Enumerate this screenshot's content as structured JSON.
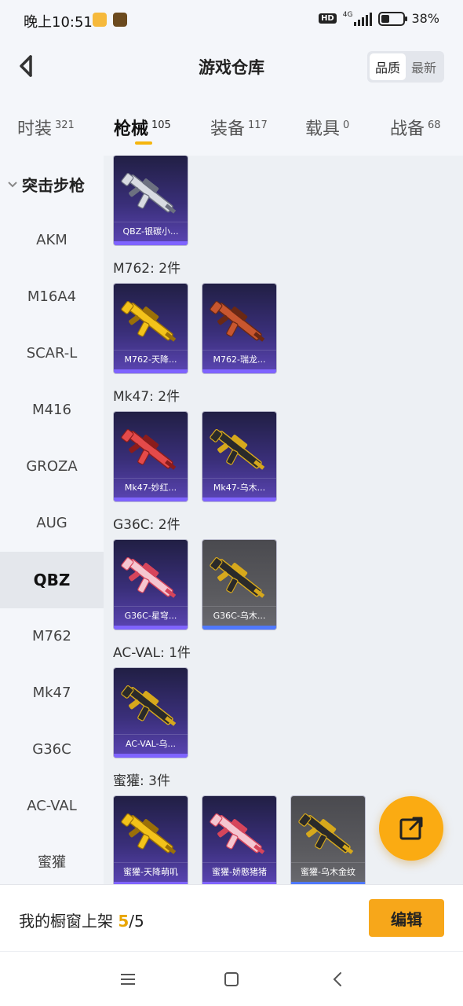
{
  "status": {
    "time": "晚上10:51",
    "network": "4G",
    "hd": "HD",
    "battery_percent": "38%",
    "battery_level": 0.38
  },
  "header": {
    "title": "游戏仓库",
    "sort_options": [
      "品质",
      "最新"
    ],
    "sort_active": 0
  },
  "tabs": [
    {
      "label": "时装",
      "count": "321"
    },
    {
      "label": "枪械",
      "count": "105"
    },
    {
      "label": "装备",
      "count": "117"
    },
    {
      "label": "载具",
      "count": "0"
    },
    {
      "label": "战备",
      "count": "68"
    }
  ],
  "sidebar": {
    "header": "突击步枪",
    "items": [
      "AKM",
      "M16A4",
      "SCAR-L",
      "M416",
      "GROZA",
      "AUG",
      "QBZ",
      "M762",
      "Mk47",
      "G36C",
      "AC-VAL",
      "蜜獾"
    ],
    "active": "QBZ"
  },
  "groups": [
    {
      "title": "",
      "items": [
        {
          "name": "QBZ-银碳小...",
          "bg": "purple",
          "gun": "silver"
        }
      ]
    },
    {
      "title": "M762: 2件",
      "items": [
        {
          "name": "M762-天降...",
          "bg": "purple",
          "gun": "gold"
        },
        {
          "name": "M762-瑞龙...",
          "bg": "purple",
          "gun": "copper"
        }
      ]
    },
    {
      "title": "Mk47: 2件",
      "items": [
        {
          "name": "Mk47-妙红...",
          "bg": "purple",
          "gun": "red"
        },
        {
          "name": "Mk47-乌木...",
          "bg": "purple",
          "gun": "blackgold"
        }
      ]
    },
    {
      "title": "G36C: 2件",
      "items": [
        {
          "name": "G36C-星穹...",
          "bg": "purple",
          "gun": "pink"
        },
        {
          "name": "G36C-乌木...",
          "bg": "gray",
          "gun": "blackgold"
        }
      ]
    },
    {
      "title": "AC-VAL: 1件",
      "items": [
        {
          "name": "AC-VAL-乌...",
          "bg": "purple",
          "gun": "blackgold"
        }
      ]
    },
    {
      "title": "蜜獾: 3件",
      "items": [
        {
          "name": "蜜獾-天降萌叽",
          "bg": "purple",
          "gun": "gold"
        },
        {
          "name": "蜜獾-娇憨猪猪",
          "bg": "purple",
          "gun": "pink"
        },
        {
          "name": "蜜獾-乌木金纹",
          "bg": "gray",
          "gun": "blackgold"
        }
      ]
    }
  ],
  "gun_colors": {
    "silver": [
      "#d8dbe2",
      "#6c7080"
    ],
    "gold": [
      "#f3c21a",
      "#9a6f08"
    ],
    "copper": [
      "#c8562f",
      "#6a2814"
    ],
    "red": [
      "#e44a4a",
      "#8a1c1c"
    ],
    "blackgold": [
      "#2a2a2a",
      "#d6a81c"
    ],
    "pink": [
      "#f5c6d0",
      "#d6455b"
    ]
  },
  "bottom": {
    "shelf_label": "我的橱窗上架",
    "shelf_count": "5",
    "shelf_sep": "/",
    "shelf_total": "5",
    "edit_label": "编辑"
  },
  "icons": {
    "back": "back-arrow-icon",
    "fab": "share-out-icon",
    "nav": [
      "menu-icon",
      "home-icon",
      "back-icon"
    ]
  }
}
